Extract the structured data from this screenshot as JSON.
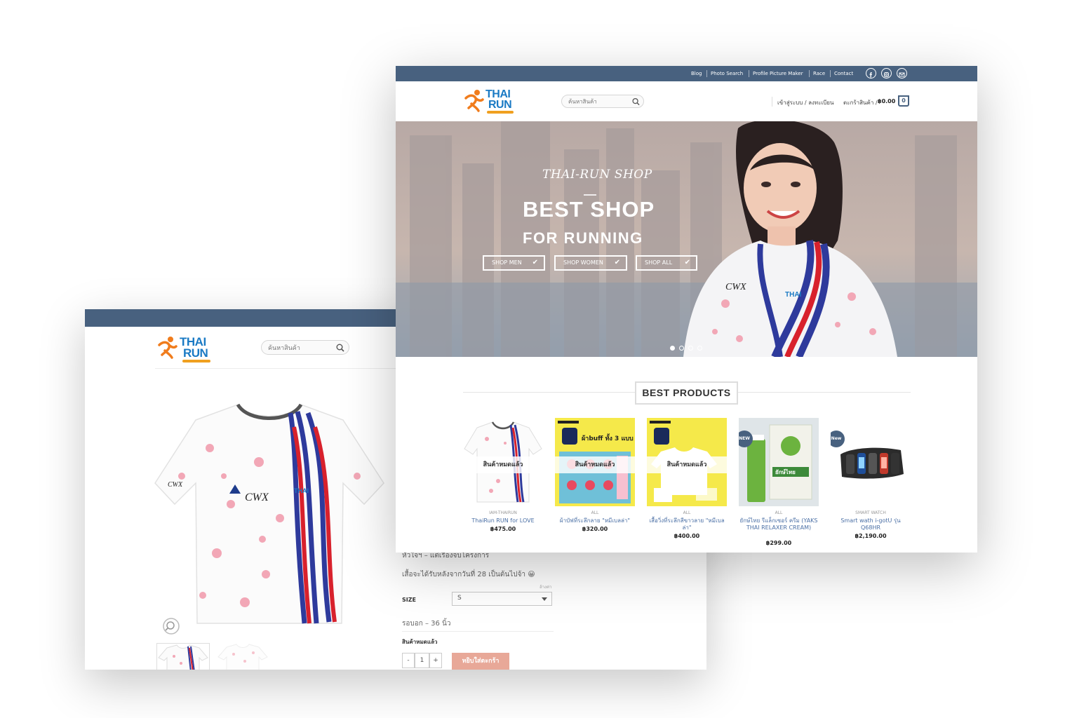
{
  "back_window": {
    "logo": {
      "line1": "THAI",
      "line2": "RUN"
    },
    "search": {
      "placeholder": "ค้นหาสินค้า"
    },
    "desc_line1": "หัวใจฯ – แต่เรื่องจบโครงการ",
    "desc_line2": "เสื้อจะได้รับหลังจากวันที่ 28 เป็นต้นไปจ้า 😀",
    "clear_link": "ล้างค่า",
    "size_label": "SIZE",
    "size_value": "S",
    "chest_text": "รอบอก – 36 นิ้ว",
    "stock_text": "สินค้าหมดแล้ว",
    "qty": {
      "minus": "-",
      "value": "1",
      "plus": "+"
    },
    "add_to_cart": "หยิบใส่ตะกร้า"
  },
  "front_window": {
    "topbar": {
      "links": [
        "Blog",
        "Photo Search",
        "Profile Picture Maker",
        "Race",
        "Contact"
      ],
      "social_icons": [
        "facebook-icon",
        "instagram-icon",
        "email-icon"
      ]
    },
    "logo": {
      "line1": "THAI",
      "line2": "RUN"
    },
    "search": {
      "placeholder": "ค้นหาสินค้า"
    },
    "account": "เข้าสู่ระบบ / ลงทะเบียน",
    "cart_label": "ตะกร้าสินค้า /",
    "cart_total": "฿0.00",
    "cart_count": "0",
    "hero": {
      "script": "THAI-RUN SHOP",
      "title": "BEST SHOP",
      "subtitle": "FOR RUNNING",
      "buttons": [
        "SHOP MEN",
        "SHOP WOMEN",
        "SHOP ALL"
      ],
      "slides": 4,
      "active_slide": 1
    },
    "section_title": "BEST PRODUCTS",
    "products": [
      {
        "category": "IAM-THAIRUN",
        "name": "ThaiRun RUN for LOVE",
        "price": "฿475.00",
        "soldout": "สินค้าหมดแล้ว",
        "badge": ""
      },
      {
        "category": "ALL",
        "name": "ผ้าบัฟที่ระลึกลาย \"หมีเบลล่า\"",
        "price": "฿320.00",
        "soldout": "สินค้าหมดแล้ว",
        "badge": "",
        "art_top": "ผ้าbuff ทั้ง 3 แบบ"
      },
      {
        "category": "ALL",
        "name": "เสื้อวิ่งที่ระลึกสีขาวลาย \"หมีเบลล่า\"",
        "price": "฿400.00",
        "soldout": "สินค้าหมดแล้ว",
        "badge": ""
      },
      {
        "category": "ALL",
        "name": "ยักษ์ไทย รีแล็กเซอร์ ครีม (YAKS THAI RELAXER CREAM)",
        "price": "฿299.00",
        "soldout": "",
        "badge": "NEW",
        "art_top": "ยักษ์ไทย"
      },
      {
        "category": "SMART WATCH",
        "name": "Smart wath i-gotU รุ่น Q68HR",
        "price": "฿2,190.00",
        "soldout": "",
        "badge": "New"
      }
    ]
  },
  "colors": {
    "navy": "#48617f",
    "logo_blue": "#1a7ac4",
    "logo_orange": "#f0a020",
    "link_blue": "#4a6fa5",
    "cart_button": "#e8a898",
    "product_yellow": "#f5e94a"
  }
}
